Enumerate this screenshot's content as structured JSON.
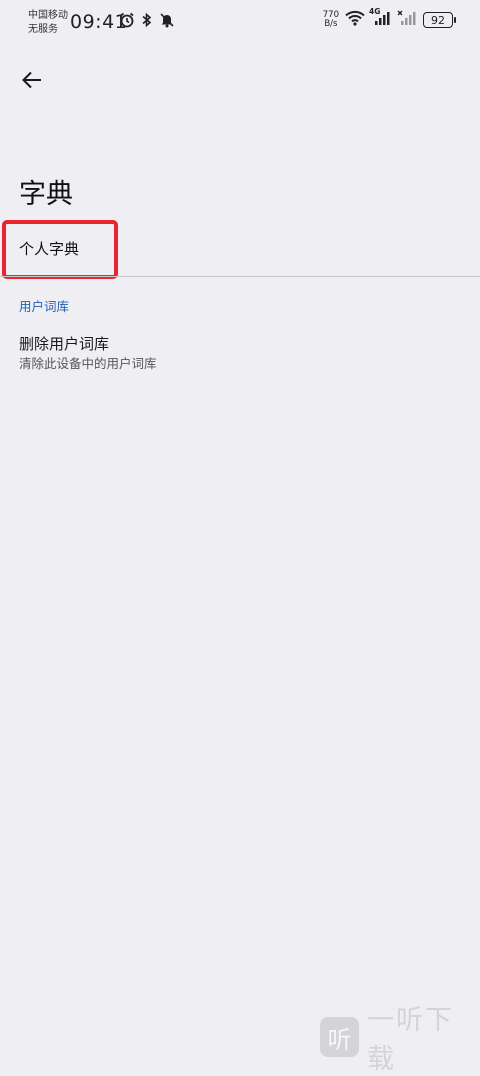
{
  "status_bar": {
    "carrier_line1": "中国移动",
    "carrier_line2": "无服务",
    "time": "09:41",
    "net_speed_value": "770",
    "net_speed_unit": "B/s",
    "signal_label": "4G",
    "battery": "92",
    "icons": [
      "alarm-icon",
      "bluetooth-icon",
      "mute-icon",
      "wifi-icon",
      "signal-icon",
      "no-signal-icon",
      "battery-icon"
    ]
  },
  "toolbar": {
    "back_icon": "back-arrow-icon"
  },
  "page": {
    "title": "字典"
  },
  "personal_dictionary": {
    "label": "个人字典"
  },
  "section": {
    "header": "用户词库"
  },
  "delete_item": {
    "title": "删除用户词库",
    "subtitle": "清除此设备中的用户词库"
  },
  "watermark": {
    "logo_text": "听",
    "text": "一听下载"
  },
  "colors": {
    "accent": "#1f5fb5",
    "highlight": "#e8262b",
    "background": "#efeff3"
  }
}
